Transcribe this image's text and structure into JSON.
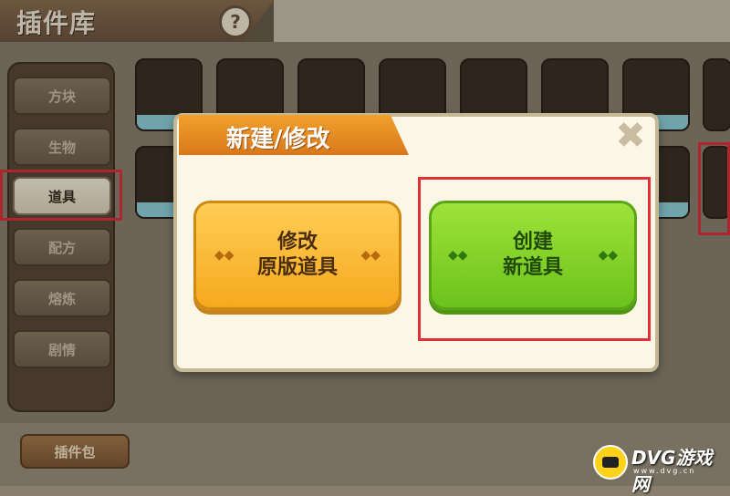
{
  "header": {
    "title": "插件库",
    "help": "?"
  },
  "sidebar": {
    "items": [
      {
        "label": "方块"
      },
      {
        "label": "生物"
      },
      {
        "label": "道具"
      },
      {
        "label": "配方"
      },
      {
        "label": "熔炼"
      },
      {
        "label": "剧情"
      }
    ]
  },
  "footer": {
    "plugin_button": "插件包"
  },
  "dialog": {
    "title": "新建/修改",
    "close": "✖",
    "option_modify": {
      "line1": "修改",
      "line2": "原版道具"
    },
    "option_create": {
      "line1": "创建",
      "line2": "新道具"
    }
  },
  "watermark": {
    "brand": "DVG游戏网",
    "site": "www.dvg.cn"
  },
  "colors": {
    "highlight": "#e0303a",
    "orange_button": "#f6a91f",
    "green_button": "#6cc21c"
  }
}
